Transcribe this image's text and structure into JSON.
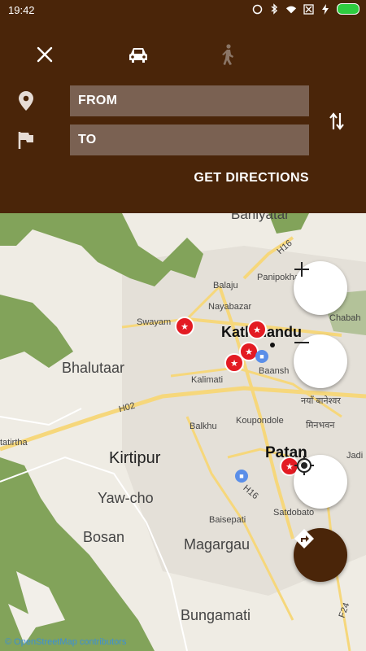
{
  "status": {
    "time": "19:42"
  },
  "colors": {
    "header": "#4a2509",
    "field": "#7a6152",
    "park": "#82a35a",
    "road": "#f6d77b"
  },
  "header": {
    "from_placeholder": "FROM",
    "to_placeholder": "TO",
    "get_directions": "GET DIRECTIONS",
    "icons": [
      "close-icon",
      "car-icon",
      "walk-icon",
      "location-pin-icon",
      "flag-icon",
      "swap-icon"
    ]
  },
  "map": {
    "labels": {
      "baniyatar": "Baniyatar",
      "h16a": "H16",
      "panipokhari": "Panipokhari",
      "balaju": "Balaju",
      "nayabazar": "Nayabazar",
      "swayam": "Swayam",
      "kathmandu": "Kathmandu",
      "chabahil": "Chabah",
      "bhalutaar": "Bhalutaar",
      "baansh": "Baansh",
      "kalimati": "Kalimati",
      "naya_baneshwar": "नयाँ बानेश्वर",
      "h02": "H02",
      "balkhu": "Balkhu",
      "koupondole": "Koupondole",
      "minbhawan": "मिनभवन",
      "tatirtha": "tatirtha",
      "kirtipur": "Kirtipur",
      "patan": "Patan",
      "jadi": "Jadi",
      "h16b": "H16",
      "yawcho": "Yaw-cho",
      "baisepati": "Baisepati",
      "satdobato": "Satdobato",
      "bosan": "Bosan",
      "magargau": "Magargau",
      "bungamati": "Bungamati",
      "f24": "F24"
    },
    "attribution": "© OpenStreetMap contributors",
    "controls": [
      "zoom-in-icon",
      "zoom-out-icon",
      "my-location-icon",
      "directions-icon"
    ]
  }
}
